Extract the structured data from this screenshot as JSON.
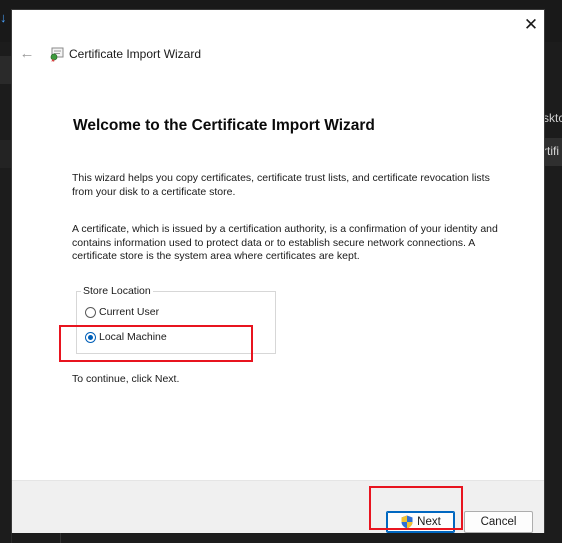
{
  "background": {
    "right_label": "sktc",
    "right_field_text": "rtifi"
  },
  "dialog": {
    "title": "Certificate Import Wizard",
    "close_glyph": "✕",
    "back_glyph": "←",
    "heading": "Welcome to the Certificate Import Wizard",
    "intro_text": "This wizard helps you copy certificates, certificate trust lists, and certificate revocation lists from your disk to a certificate store.",
    "description_text": "A certificate, which is issued by a certification authority, is a confirmation of your identity and contains information used to protect data or to establish secure network connections. A certificate store is the system area where certificates are kept.",
    "store_location": {
      "legend": "Store Location",
      "options": [
        {
          "label": "Current User",
          "selected": false
        },
        {
          "label": "Local Machine",
          "selected": true
        }
      ]
    },
    "continue_text": "To continue, click Next.",
    "buttons": {
      "next_label": "Next",
      "cancel_label": "Cancel"
    }
  },
  "colors": {
    "highlight": "#e8141f",
    "accent": "#005fb8",
    "footer_bg": "#f0f0f0"
  },
  "icons": [
    "certificate-icon",
    "back-arrow-icon",
    "close-icon",
    "uac-shield-icon"
  ]
}
